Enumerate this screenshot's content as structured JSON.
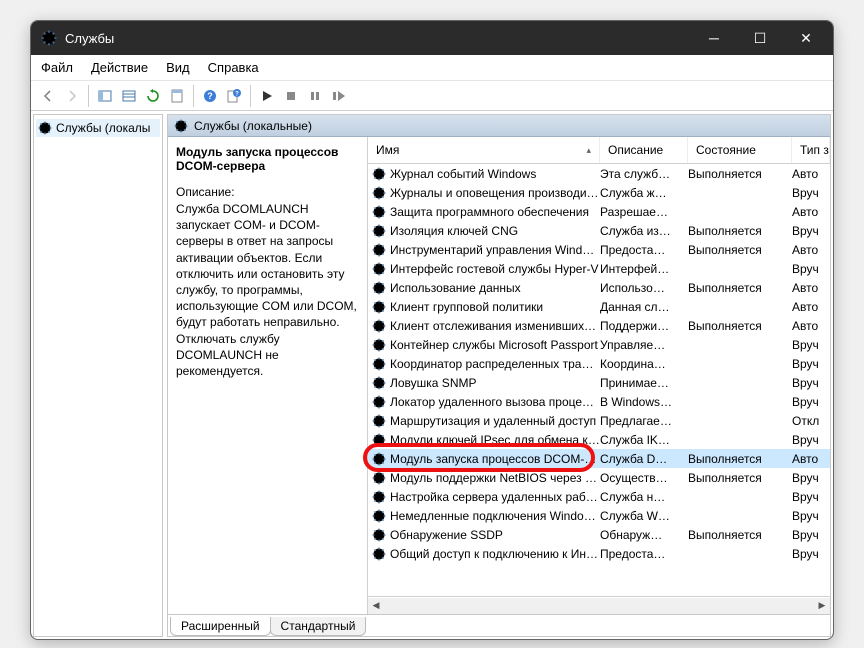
{
  "title": "Службы",
  "menus": {
    "file": "Файл",
    "action": "Действие",
    "view": "Вид",
    "help": "Справка"
  },
  "tree": {
    "root": "Службы (локалы",
    "root_full": "Службы (локальные)"
  },
  "right_header": "Службы (локальные)",
  "info": {
    "title": "Модуль запуска процессов DCOM-сервера",
    "desc_label": "Описание:",
    "desc": "Служба DCOMLAUNCH запускает COM- и DCOM-серверы в ответ на запросы активации объектов. Если отключить или остановить эту службу, то программы, использующие COM или DCOM, будут работать неправильно. Отключать службу DCOMLAUNCH не рекомендуется."
  },
  "columns": {
    "name": "Имя",
    "desc": "Описание",
    "state": "Состояние",
    "type": "Тип з"
  },
  "tabs": {
    "extended": "Расширенный",
    "standard": "Стандартный"
  },
  "services": [
    {
      "name": "Журнал событий Windows",
      "desc": "Эта служб…",
      "state": "Выполняется",
      "type": "Авто"
    },
    {
      "name": "Журналы и оповещения производите…",
      "desc": "Служба ж…",
      "state": "",
      "type": "Вруч"
    },
    {
      "name": "Защита программного обеспечения",
      "desc": "Разрешае…",
      "state": "",
      "type": "Авто"
    },
    {
      "name": "Изоляция ключей CNG",
      "desc": "Служба из…",
      "state": "Выполняется",
      "type": "Вруч"
    },
    {
      "name": "Инструментарий управления Windows",
      "desc": "Предоста…",
      "state": "Выполняется",
      "type": "Авто"
    },
    {
      "name": "Интерфейс гостевой службы Hyper-V",
      "desc": "Интерфей…",
      "state": "",
      "type": "Вруч"
    },
    {
      "name": "Использование данных",
      "desc": "Использо…",
      "state": "Выполняется",
      "type": "Авто"
    },
    {
      "name": "Клиент групповой политики",
      "desc": "Данная сл…",
      "state": "",
      "type": "Авто"
    },
    {
      "name": "Клиент отслеживания изменившихся …",
      "desc": "Поддержи…",
      "state": "Выполняется",
      "type": "Авто"
    },
    {
      "name": "Контейнер службы Microsoft Passport",
      "desc": "Управляе…",
      "state": "",
      "type": "Вруч"
    },
    {
      "name": "Координатор распределенных транза…",
      "desc": "Координа…",
      "state": "",
      "type": "Вруч"
    },
    {
      "name": "Ловушка SNMP",
      "desc": "Принимае…",
      "state": "",
      "type": "Вруч"
    },
    {
      "name": "Локатор удаленного вызова процеду…",
      "desc": "В Windows…",
      "state": "",
      "type": "Вруч"
    },
    {
      "name": "Маршрутизация и удаленный доступ",
      "desc": "Предлагае…",
      "state": "",
      "type": "Откл"
    },
    {
      "name": "Модули ключей IPsec для обмена кл…",
      "desc": "Служба IK…",
      "state": "",
      "type": "Вруч"
    },
    {
      "name": "Модуль запуска процессов DCOM-се…",
      "desc": "Служба D…",
      "state": "Выполняется",
      "type": "Авто",
      "highlighted": true
    },
    {
      "name": "Модуль поддержки NetBIOS через TC…",
      "desc": "Осуществ…",
      "state": "Выполняется",
      "type": "Вруч"
    },
    {
      "name": "Настройка сервера удаленных рабоч…",
      "desc": "Служба н…",
      "state": "",
      "type": "Вруч"
    },
    {
      "name": "Немедленные подключения Windows…",
      "desc": "Служба W…",
      "state": "",
      "type": "Вруч"
    },
    {
      "name": "Обнаружение SSDP",
      "desc": "Обнаруж…",
      "state": "Выполняется",
      "type": "Вруч"
    },
    {
      "name": "Общий доступ к подключению к Инт…",
      "desc": "Предоста…",
      "state": "",
      "type": "Вруч"
    }
  ]
}
